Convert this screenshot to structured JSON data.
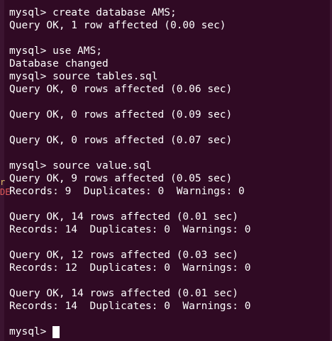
{
  "terminal": {
    "lines": [
      "mysql> create database AMS;",
      "Query OK, 1 row affected (0.00 sec)",
      "",
      "mysql> use AMS;",
      "Database changed",
      "mysql> source tables.sql",
      "Query OK, 0 rows affected (0.06 sec)",
      "",
      "Query OK, 0 rows affected (0.09 sec)",
      "",
      "Query OK, 0 rows affected (0.07 sec)",
      "",
      "mysql> source value.sql",
      "Query OK, 9 rows affected (0.05 sec)",
      "Records: 9  Duplicates: 0  Warnings: 0",
      "",
      "Query OK, 14 rows affected (0.01 sec)",
      "Records: 14  Duplicates: 0  Warnings: 0",
      "",
      "Query OK, 12 rows affected (0.03 sec)",
      "Records: 12  Duplicates: 0  Warnings: 0",
      "",
      "Query OK, 14 rows affected (0.01 sec)",
      "Records: 14  Duplicates: 0  Warnings: 0",
      ""
    ],
    "prompt": "mysql> ",
    "edge_chars": [
      "r",
      "DE"
    ]
  },
  "colors": {
    "background": "#300a24",
    "text": "#ffffff",
    "edge_char_1": "#e7c36b",
    "edge_char_2": "#e35b5b"
  }
}
